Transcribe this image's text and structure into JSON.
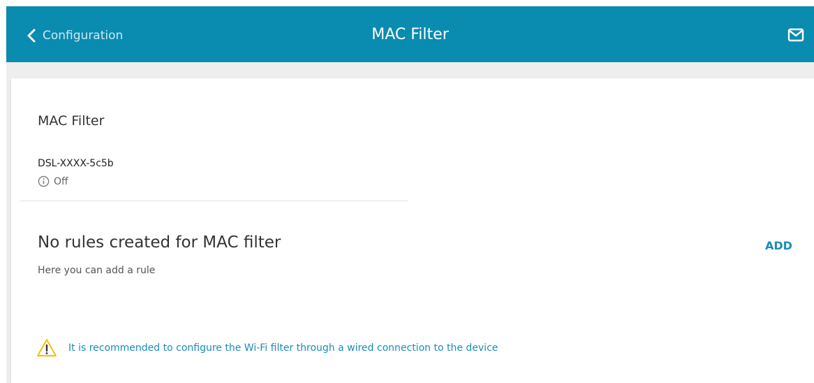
{
  "header": {
    "back_label": "Configuration",
    "title": "MAC Filter",
    "bar_color": "#0a8bb0",
    "icons": {
      "back": "chevron-left-icon",
      "mail": "mail-icon"
    }
  },
  "section": {
    "title": "MAC Filter",
    "network_name": "DSL-XXXX-5c5b",
    "status": "Off",
    "status_icon": "info-icon"
  },
  "rules": {
    "title": "No rules created for MAC filter",
    "add_label": "ADD",
    "hint": "Here you can add a rule",
    "accent_color": "#1a8cb8"
  },
  "warning": {
    "icon": "warning-icon",
    "text": "It is recommended to configure the Wi-Fi filter through a wired connection to the device",
    "icon_color": "#f2c200"
  }
}
